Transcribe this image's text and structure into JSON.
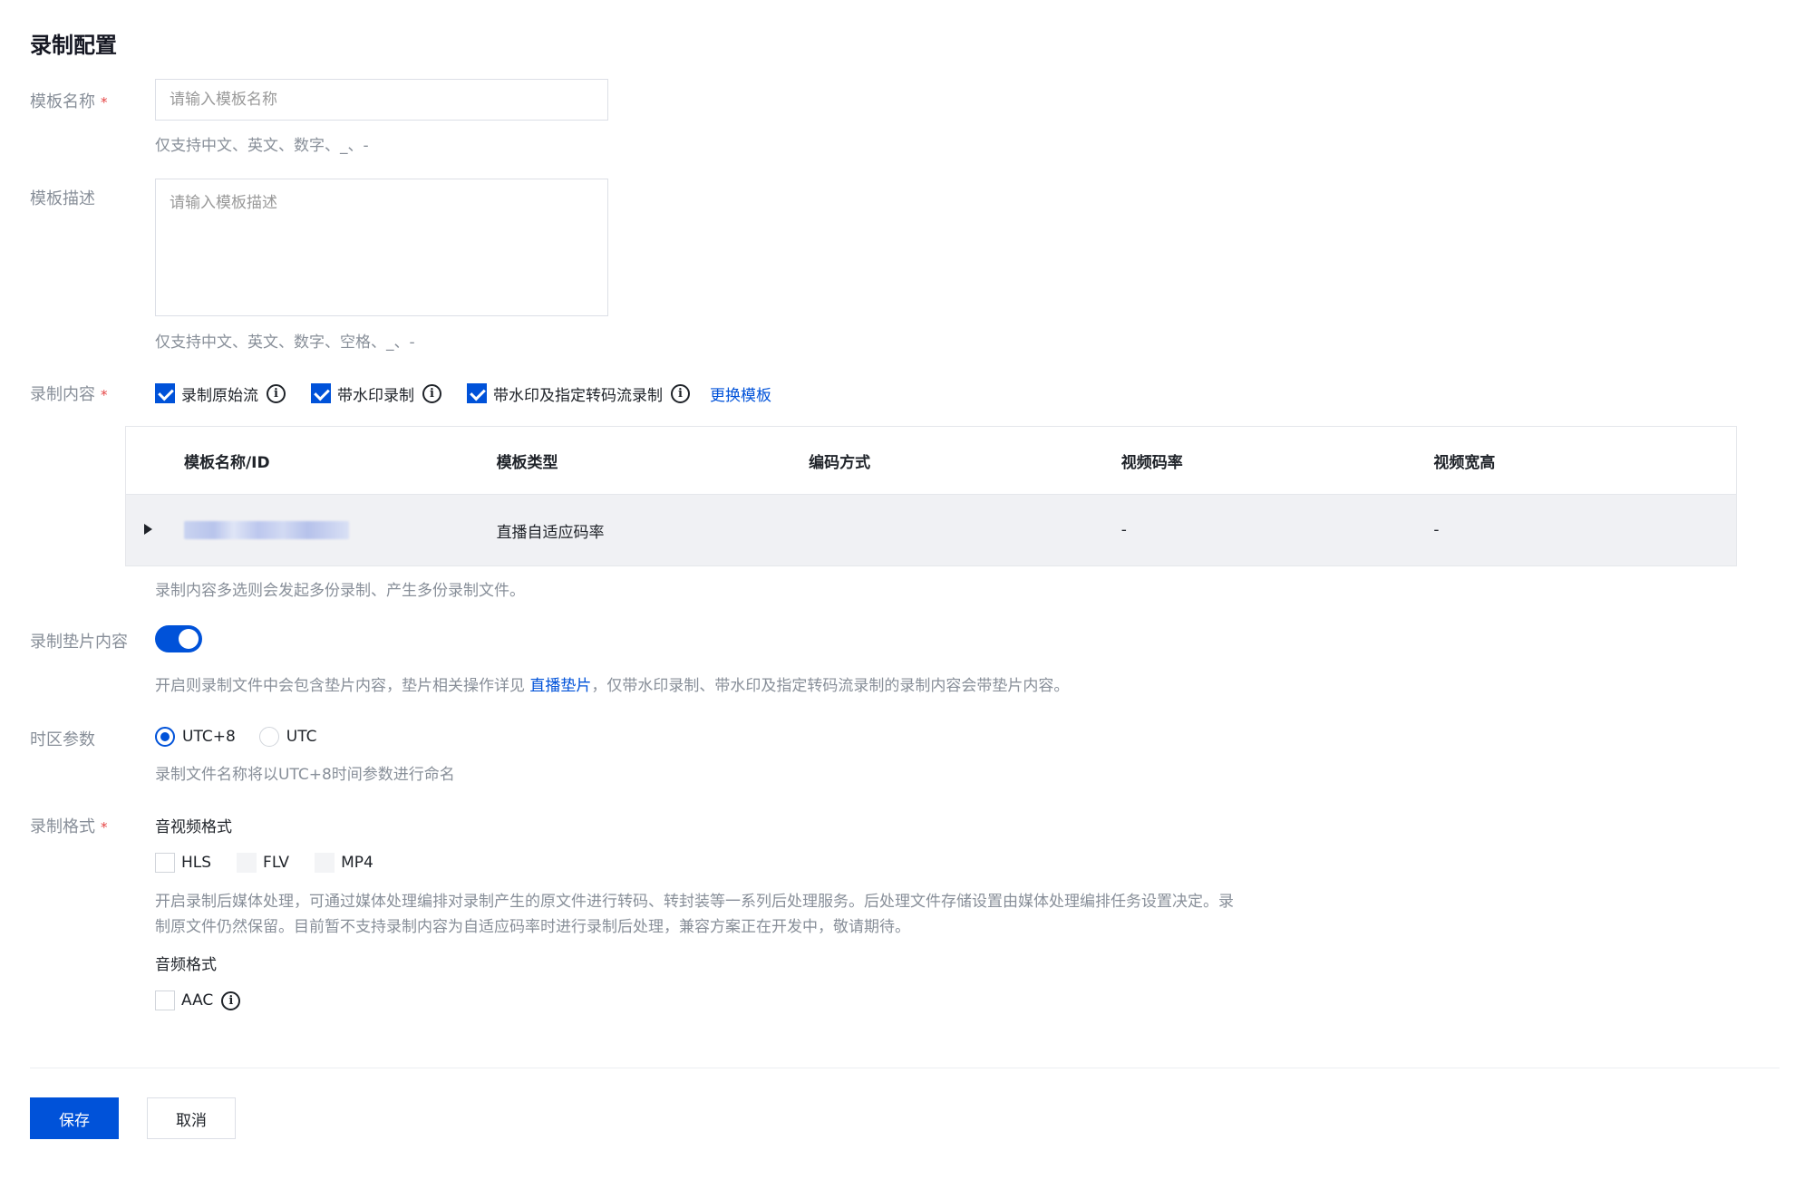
{
  "page": {
    "title": "录制配置"
  },
  "template_name": {
    "label": "模板名称",
    "required_mark": "*",
    "placeholder": "请输入模板名称",
    "value": "",
    "hint": "仅支持中文、英文、数字、_、-"
  },
  "template_desc": {
    "label": "模板描述",
    "placeholder": "请输入模板描述",
    "value": "",
    "hint": "仅支持中文、英文、数字、空格、_、-"
  },
  "record_content": {
    "label": "录制内容",
    "required_mark": "*",
    "options": [
      {
        "label": "录制原始流",
        "checked": true
      },
      {
        "label": "带水印录制",
        "checked": true
      },
      {
        "label": "带水印及指定转码流录制",
        "checked": true
      }
    ],
    "info_glyph": "i",
    "change_template_link": "更换模板",
    "table": {
      "headers": [
        "模板名称/ID",
        "模板类型",
        "编码方式",
        "视频码率",
        "视频宽高"
      ],
      "rows": [
        {
          "name_id": "",
          "type": "直播自适应码率",
          "codec": "",
          "bitrate": "-",
          "resolution": "-"
        }
      ]
    },
    "hint": "录制内容多选则会发起多份录制、产生多份录制文件。"
  },
  "slate": {
    "label": "录制垫片内容",
    "enabled": true,
    "hint_before": "开启则录制文件中会包含垫片内容，垫片相关操作详见 ",
    "hint_link": "直播垫片",
    "hint_after": "，仅带水印录制、带水印及指定转码流录制的录制内容会带垫片内容。"
  },
  "timezone": {
    "label": "时区参数",
    "options": [
      {
        "label": "UTC+8",
        "selected": true
      },
      {
        "label": "UTC",
        "selected": false
      }
    ],
    "hint": "录制文件名称将以UTC+8时间参数进行命名"
  },
  "record_format": {
    "label": "录制格式",
    "required_mark": "*",
    "av_title": "音视频格式",
    "av_options": [
      {
        "label": "HLS",
        "checked": false,
        "disabled": false
      },
      {
        "label": "FLV",
        "checked": false,
        "disabled": true
      },
      {
        "label": "MP4",
        "checked": false,
        "disabled": true
      }
    ],
    "av_hint_line1": "开启录制后媒体处理，可通过媒体处理编排对录制产生的原文件进行转码、转封装等一系列后处理服务。后处理文件存储设置由媒体处理编排任务设置决定。录",
    "av_hint_line2": "制原文件仍然保留。目前暂不支持录制内容为自适应码率时进行录制后处理，兼容方案正在开发中，敬请期待。",
    "audio_title": "音频格式",
    "audio_options": [
      {
        "label": "AAC",
        "checked": false
      }
    ]
  },
  "actions": {
    "save": "保存",
    "cancel": "取消"
  },
  "colors": {
    "primary": "#0052d9",
    "required": "#e54545",
    "label": "#888f99"
  }
}
